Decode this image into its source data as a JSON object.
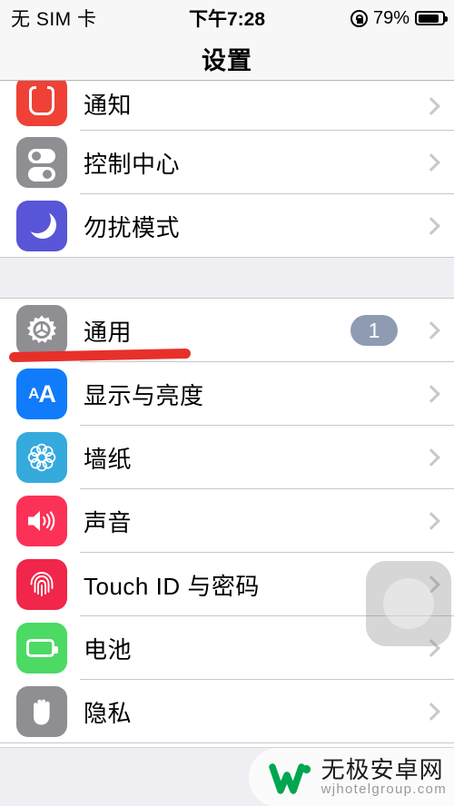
{
  "status_bar": {
    "carrier": "无 SIM 卡",
    "time": "下午7:28",
    "battery_percent": "79%",
    "battery_level": 79,
    "rotation_lock_icon": "rotation-lock-icon",
    "battery_icon": "battery-icon"
  },
  "nav": {
    "title": "设置"
  },
  "groups": [
    {
      "rows": [
        {
          "label": "通知",
          "icon": "notifications-icon",
          "icon_color": "#EF4136",
          "badge": null,
          "clipped": true
        },
        {
          "label": "控制中心",
          "icon": "control-center-icon",
          "icon_color": "#8E8E93",
          "badge": null
        },
        {
          "label": "勿扰模式",
          "icon": "do-not-disturb-moon-icon",
          "icon_color": "#5856D6",
          "badge": null
        }
      ]
    },
    {
      "rows": [
        {
          "label": "通用",
          "icon": "gear-icon",
          "icon_color": "#8E8E93",
          "badge": "1"
        },
        {
          "label": "显示与亮度",
          "icon": "display-aa-icon",
          "icon_color": "#107BFB",
          "badge": null
        },
        {
          "label": "墙纸",
          "icon": "wallpaper-flower-icon",
          "icon_color": "#35AADC",
          "badge": null
        },
        {
          "label": "声音",
          "icon": "speaker-icon",
          "icon_color": "#FC3158",
          "badge": null
        },
        {
          "label": "Touch ID 与密码",
          "icon": "fingerprint-icon",
          "icon_color": "#F0264A",
          "badge": null
        },
        {
          "label": "电池",
          "icon": "battery-icon",
          "icon_color": "#4CD964",
          "badge": null
        },
        {
          "label": "隐私",
          "icon": "hand-privacy-icon",
          "icon_color": "#8E8E93",
          "badge": null
        }
      ]
    }
  ],
  "annotation": {
    "type": "red-underline",
    "target": "通用",
    "color": "#E8302A"
  },
  "assistive_touch": {
    "name": "assistive-touch-button"
  },
  "watermark": {
    "site_name": "无极安卓网",
    "url": "wjhotelgroup.com",
    "logo_color": "#00A650"
  }
}
